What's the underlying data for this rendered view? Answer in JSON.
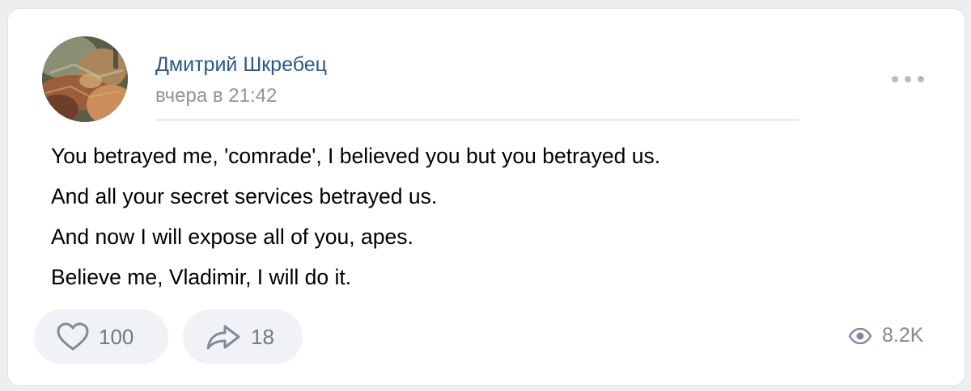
{
  "post": {
    "author": "Дмитрий Шкребец",
    "date": "вчера в 21:42",
    "text_lines": [
      "You betrayed me, 'comrade', I believed you but you betrayed us.",
      "And all your secret services betrayed us.",
      "And now I will expose all of you, apes.",
      "Believe me, Vladimir, I will do it."
    ]
  },
  "actions": {
    "likes": "100",
    "shares": "18",
    "views": "8.2K"
  },
  "icons": {
    "avatar": "avatar-photo",
    "more": "more-dots-icon",
    "like": "heart-icon",
    "share": "share-arrow-icon",
    "views": "eye-icon"
  },
  "colors": {
    "author": "#2a5885",
    "muted": "#939393",
    "action_bg": "#f0f2f5",
    "icon": "#828a99"
  }
}
